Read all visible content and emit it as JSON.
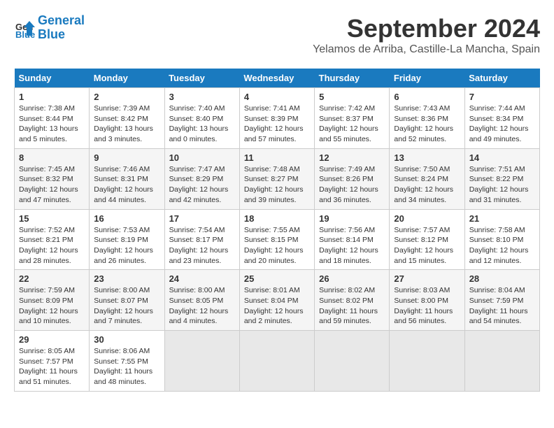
{
  "header": {
    "logo_line1": "General",
    "logo_line2": "Blue",
    "title": "September 2024",
    "subtitle": "Yelamos de Arriba, Castille-La Mancha, Spain"
  },
  "calendar": {
    "columns": [
      "Sunday",
      "Monday",
      "Tuesday",
      "Wednesday",
      "Thursday",
      "Friday",
      "Saturday"
    ],
    "weeks": [
      [
        {
          "day": "",
          "empty": true
        },
        {
          "day": "",
          "empty": true
        },
        {
          "day": "",
          "empty": true
        },
        {
          "day": "",
          "empty": true
        },
        {
          "day": "",
          "empty": true
        },
        {
          "day": "",
          "empty": true
        },
        {
          "day": "7",
          "info": "Sunrise: 7:44 AM\nSunset: 8:34 PM\nDaylight: 12 hours\nand 49 minutes."
        }
      ],
      [
        {
          "day": "1",
          "info": "Sunrise: 7:38 AM\nSunset: 8:44 PM\nDaylight: 13 hours\nand 5 minutes."
        },
        {
          "day": "2",
          "info": "Sunrise: 7:39 AM\nSunset: 8:42 PM\nDaylight: 13 hours\nand 3 minutes."
        },
        {
          "day": "3",
          "info": "Sunrise: 7:40 AM\nSunset: 8:40 PM\nDaylight: 13 hours\nand 0 minutes."
        },
        {
          "day": "4",
          "info": "Sunrise: 7:41 AM\nSunset: 8:39 PM\nDaylight: 12 hours\nand 57 minutes."
        },
        {
          "day": "5",
          "info": "Sunrise: 7:42 AM\nSunset: 8:37 PM\nDaylight: 12 hours\nand 55 minutes."
        },
        {
          "day": "6",
          "info": "Sunrise: 7:43 AM\nSunset: 8:36 PM\nDaylight: 12 hours\nand 52 minutes."
        },
        {
          "day": "7",
          "info": "Sunrise: 7:44 AM\nSunset: 8:34 PM\nDaylight: 12 hours\nand 49 minutes."
        }
      ],
      [
        {
          "day": "8",
          "info": "Sunrise: 7:45 AM\nSunset: 8:32 PM\nDaylight: 12 hours\nand 47 minutes."
        },
        {
          "day": "9",
          "info": "Sunrise: 7:46 AM\nSunset: 8:31 PM\nDaylight: 12 hours\nand 44 minutes."
        },
        {
          "day": "10",
          "info": "Sunrise: 7:47 AM\nSunset: 8:29 PM\nDaylight: 12 hours\nand 42 minutes."
        },
        {
          "day": "11",
          "info": "Sunrise: 7:48 AM\nSunset: 8:27 PM\nDaylight: 12 hours\nand 39 minutes."
        },
        {
          "day": "12",
          "info": "Sunrise: 7:49 AM\nSunset: 8:26 PM\nDaylight: 12 hours\nand 36 minutes."
        },
        {
          "day": "13",
          "info": "Sunrise: 7:50 AM\nSunset: 8:24 PM\nDaylight: 12 hours\nand 34 minutes."
        },
        {
          "day": "14",
          "info": "Sunrise: 7:51 AM\nSunset: 8:22 PM\nDaylight: 12 hours\nand 31 minutes."
        }
      ],
      [
        {
          "day": "15",
          "info": "Sunrise: 7:52 AM\nSunset: 8:21 PM\nDaylight: 12 hours\nand 28 minutes."
        },
        {
          "day": "16",
          "info": "Sunrise: 7:53 AM\nSunset: 8:19 PM\nDaylight: 12 hours\nand 26 minutes."
        },
        {
          "day": "17",
          "info": "Sunrise: 7:54 AM\nSunset: 8:17 PM\nDaylight: 12 hours\nand 23 minutes."
        },
        {
          "day": "18",
          "info": "Sunrise: 7:55 AM\nSunset: 8:15 PM\nDaylight: 12 hours\nand 20 minutes."
        },
        {
          "day": "19",
          "info": "Sunrise: 7:56 AM\nSunset: 8:14 PM\nDaylight: 12 hours\nand 18 minutes."
        },
        {
          "day": "20",
          "info": "Sunrise: 7:57 AM\nSunset: 8:12 PM\nDaylight: 12 hours\nand 15 minutes."
        },
        {
          "day": "21",
          "info": "Sunrise: 7:58 AM\nSunset: 8:10 PM\nDaylight: 12 hours\nand 12 minutes."
        }
      ],
      [
        {
          "day": "22",
          "info": "Sunrise: 7:59 AM\nSunset: 8:09 PM\nDaylight: 12 hours\nand 10 minutes."
        },
        {
          "day": "23",
          "info": "Sunrise: 8:00 AM\nSunset: 8:07 PM\nDaylight: 12 hours\nand 7 minutes."
        },
        {
          "day": "24",
          "info": "Sunrise: 8:00 AM\nSunset: 8:05 PM\nDaylight: 12 hours\nand 4 minutes."
        },
        {
          "day": "25",
          "info": "Sunrise: 8:01 AM\nSunset: 8:04 PM\nDaylight: 12 hours\nand 2 minutes."
        },
        {
          "day": "26",
          "info": "Sunrise: 8:02 AM\nSunset: 8:02 PM\nDaylight: 11 hours\nand 59 minutes."
        },
        {
          "day": "27",
          "info": "Sunrise: 8:03 AM\nSunset: 8:00 PM\nDaylight: 11 hours\nand 56 minutes."
        },
        {
          "day": "28",
          "info": "Sunrise: 8:04 AM\nSunset: 7:59 PM\nDaylight: 11 hours\nand 54 minutes."
        }
      ],
      [
        {
          "day": "29",
          "info": "Sunrise: 8:05 AM\nSunset: 7:57 PM\nDaylight: 11 hours\nand 51 minutes."
        },
        {
          "day": "30",
          "info": "Sunrise: 8:06 AM\nSunset: 7:55 PM\nDaylight: 11 hours\nand 48 minutes."
        },
        {
          "day": "",
          "empty": true
        },
        {
          "day": "",
          "empty": true
        },
        {
          "day": "",
          "empty": true
        },
        {
          "day": "",
          "empty": true
        },
        {
          "day": "",
          "empty": true
        }
      ]
    ]
  }
}
